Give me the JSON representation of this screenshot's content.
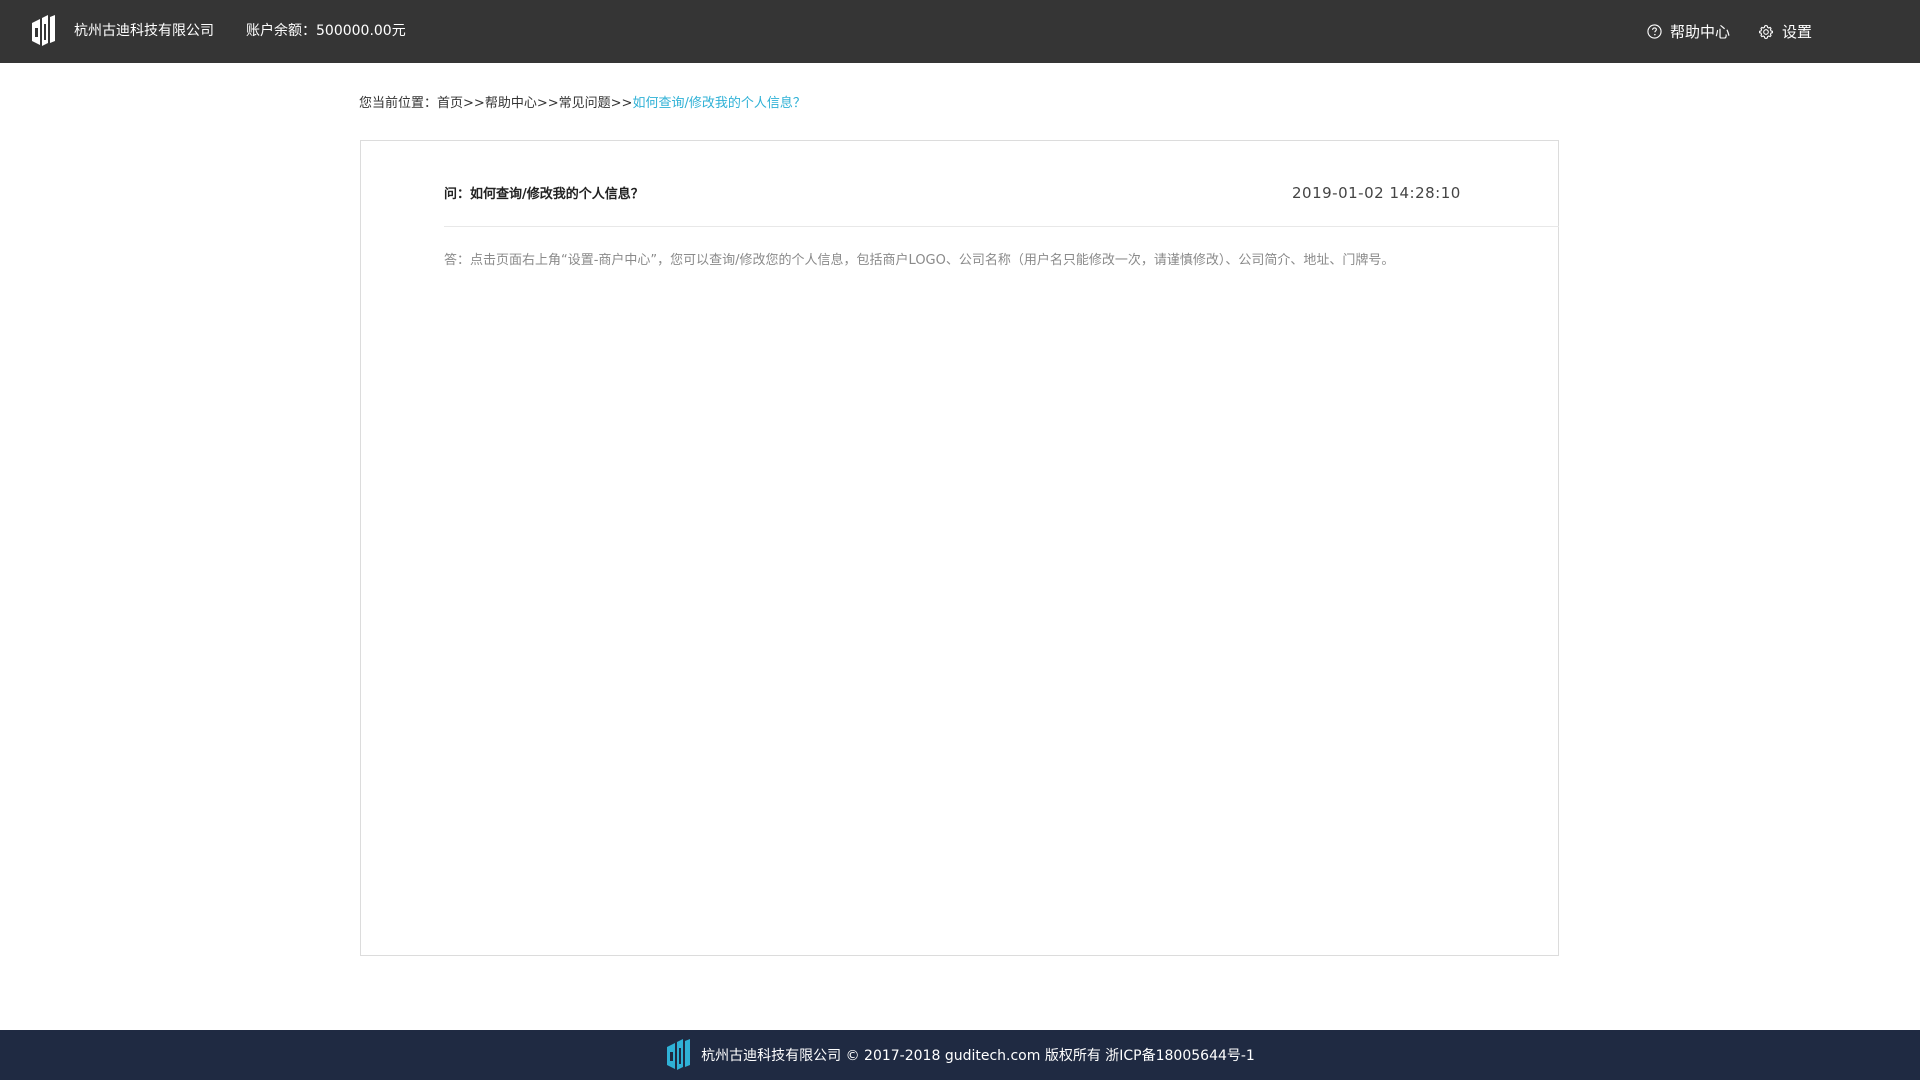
{
  "header": {
    "company_name": "杭州古迪科技有限公司",
    "balance": "账户余额：500000.00元",
    "help_label": "帮助中心",
    "settings_label": "设置"
  },
  "breadcrumb": {
    "prefix": "您当前位置：",
    "items": [
      "首页",
      "帮助中心",
      "常见问题"
    ],
    "separator": ">>",
    "current": "如何查询/修改我的个人信息？"
  },
  "faq": {
    "question": "问：如何查询/修改我的个人信息？",
    "date": "2019-01-02 14:28:10",
    "answer": "答：点击页面右上角“设置-商户中心”，您可以查询/修改您的个人信息，包括商户LOGO、公司名称（用户名只能修改一次，请谨慎修改）、公司简介、地址、门牌号。"
  },
  "footer": {
    "text": "杭州古迪科技有限公司 © 2017-2018 guditech.com 版权所有 浙ICP备18005644号-1"
  },
  "colors": {
    "header_bg": "#353535",
    "footer_bg": "#1f2a42",
    "accent": "#2fb1d6"
  },
  "icons": {
    "logo": "company-logo-icon",
    "help": "question-circle-icon",
    "settings": "gear-icon"
  }
}
